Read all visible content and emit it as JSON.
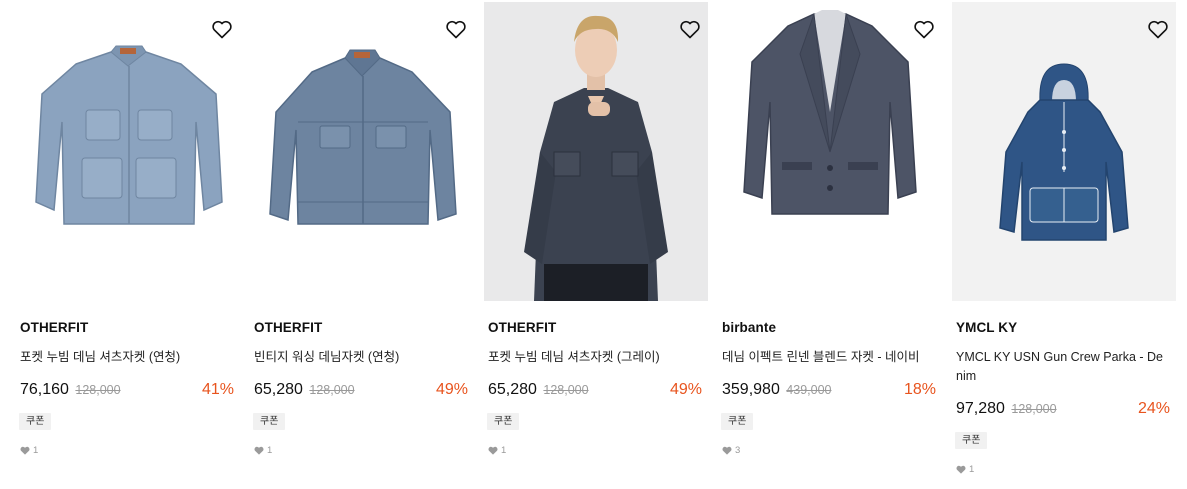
{
  "products": [
    {
      "brand": "OTHERFIT",
      "name": "포켓 누빔 데님 셔츠자켓 (연청)",
      "price": "76,160",
      "original_price": "128,000",
      "discount": "41%",
      "badge": "쿠폰",
      "likes": "1",
      "wishlist_icon": "heart-outline-icon"
    },
    {
      "brand": "OTHERFIT",
      "name": "빈티지 워싱 데님자켓 (연청)",
      "price": "65,280",
      "original_price": "128,000",
      "discount": "49%",
      "badge": "쿠폰",
      "likes": "1",
      "wishlist_icon": "heart-outline-icon"
    },
    {
      "brand": "OTHERFIT",
      "name": "포켓 누빔 데님 셔츠자켓 (그레이)",
      "price": "65,280",
      "original_price": "128,000",
      "discount": "49%",
      "badge": "쿠폰",
      "likes": "1",
      "wishlist_icon": "heart-outline-icon"
    },
    {
      "brand": "birbante",
      "name": "데님 이펙트 린넨 블렌드 자켓 - 네이비",
      "price": "359,980",
      "original_price": "439,000",
      "discount": "18%",
      "badge": "쿠폰",
      "likes": "3",
      "wishlist_icon": "heart-outline-icon"
    },
    {
      "brand": "YMCL KY",
      "name_line1": "YMCL KY USN Gun Crew Parka - De",
      "name_line2": "nim",
      "price": "97,280",
      "original_price": "128,000",
      "discount": "24%",
      "badge": "쿠폰",
      "likes": "1",
      "wishlist_icon": "heart-outline-icon"
    }
  ],
  "colors": {
    "discount": "#e8541e",
    "text": "#111111",
    "muted": "#9a9a9a",
    "badge_bg": "#f1f1f1"
  }
}
